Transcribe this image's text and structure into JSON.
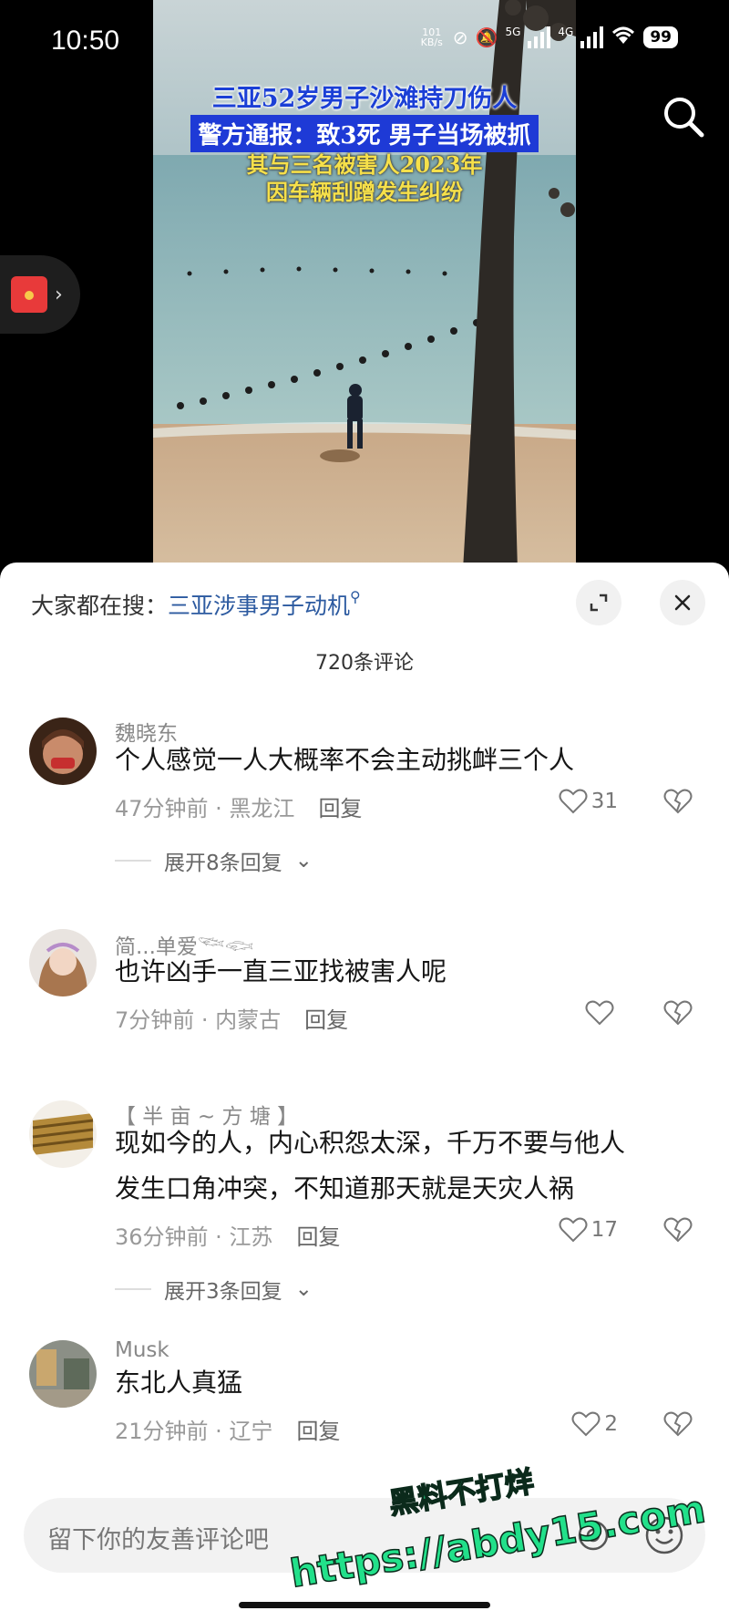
{
  "status_bar": {
    "time": "10:50",
    "speed": "101 KB/s",
    "network_1": "5G",
    "network_2": "4G",
    "battery": "99"
  },
  "video": {
    "headline_1": "三亚52岁男子沙滩持刀伤人",
    "headline_2": "警方通报：致3死 男子当场被抓",
    "headline_3": "其与三名被害人2023年",
    "headline_4": "因车辆刮蹭发生纠纷"
  },
  "panel": {
    "search_prefix": "大家都在搜：",
    "search_keyword": "三亚涉事男子动机",
    "comment_count": "720条评论"
  },
  "comments": [
    {
      "user": "魏晓东",
      "text": "个人感觉一人大概率不会主动挑衅三个人",
      "time": "47分钟前",
      "location": "黑龙江",
      "reply": "回复",
      "likes": "31",
      "expand": "展开8条回复"
    },
    {
      "user": "简...单爱𓆝𓆟",
      "text": "也许凶手一直三亚找被害人呢",
      "time": "7分钟前",
      "location": "内蒙古",
      "reply": "回复",
      "likes": ""
    },
    {
      "user": "【 半 亩 ~ 方 塘 】",
      "text_1": "现如今的人，内心积怨太深，千万不要与他人",
      "text_2": "发生口角冲突，不知道那天就是天灾人祸",
      "time": "36分钟前",
      "location": "江苏",
      "reply": "回复",
      "likes": "17",
      "expand": "展开3条回复"
    },
    {
      "user": "Musk",
      "text": "东北人真猛",
      "time": "21分钟前",
      "location": "辽宁",
      "reply": "回复",
      "likes": "2"
    }
  ],
  "input": {
    "placeholder": "留下你的友善评论吧"
  },
  "watermark": {
    "line_1": "黑料不打烊",
    "line_2": "https://abdy15.com"
  },
  "colors": {
    "link": "#2c5aa0",
    "watermark": "#22e08a",
    "headline_blue": "#1e3ad6",
    "headline_yellow": "#f6e04a"
  }
}
